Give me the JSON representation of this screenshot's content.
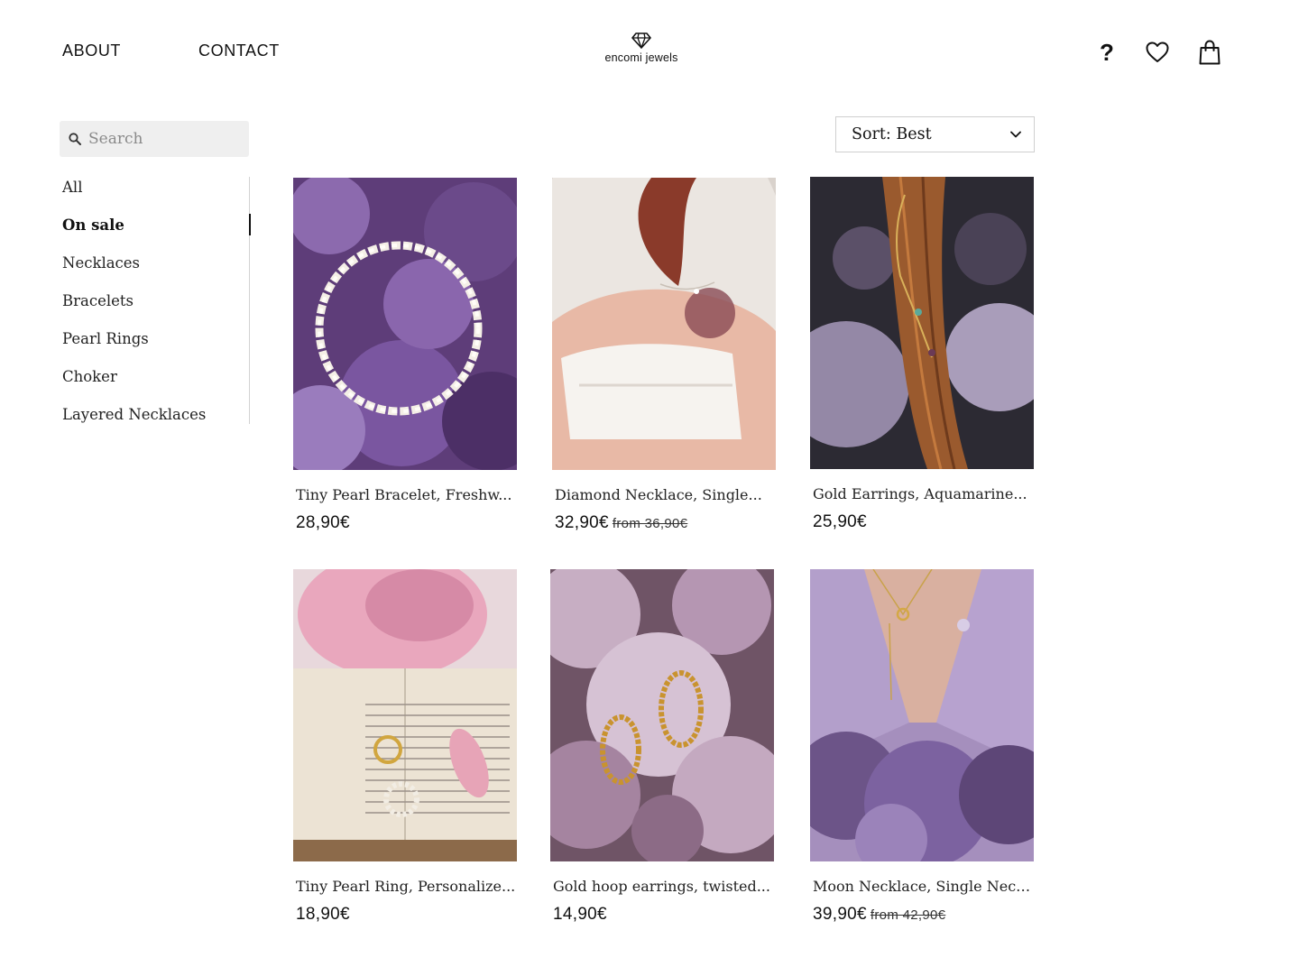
{
  "header": {
    "nav": [
      {
        "label": "ABOUT"
      },
      {
        "label": "CONTACT"
      }
    ],
    "brand": "encomi jewels",
    "icons": [
      "question-mark-icon",
      "heart-icon",
      "shopping-bag-icon"
    ],
    "help_glyph": "?"
  },
  "sidebar": {
    "search_placeholder": "Search",
    "categories": [
      {
        "label": "All",
        "active": false
      },
      {
        "label": "On sale",
        "active": true
      },
      {
        "label": "Necklaces",
        "active": false
      },
      {
        "label": "Bracelets",
        "active": false
      },
      {
        "label": "Pearl Rings",
        "active": false
      },
      {
        "label": "Choker",
        "active": false
      },
      {
        "label": "Layered Necklaces",
        "active": false
      }
    ]
  },
  "sort": {
    "label": "Sort: Best",
    "icon": "chevron-down-icon"
  },
  "products": [
    {
      "title": "Tiny Pearl Bracelet, Freshw...",
      "price": "28,90€",
      "old_price": ""
    },
    {
      "title": "Diamond Necklace,  Single...",
      "price": "32,90€",
      "old_price": "from 36,90€"
    },
    {
      "title": "Gold Earrings,  Aquamarine...",
      "price": "25,90€",
      "old_price": ""
    },
    {
      "title": "Tiny Pearl Ring, Personalize...",
      "price": "18,90€",
      "old_price": ""
    },
    {
      "title": "Gold hoop earrings, twisted...",
      "price": "14,90€",
      "old_price": ""
    },
    {
      "title": "Moon Necklace, Single Neckl...",
      "price": "39,90€",
      "old_price": "from 42,90€"
    }
  ],
  "colors": {
    "text": "#111111",
    "search_bg": "#efefef",
    "lilac": "#7a4f9a",
    "divider": "#d2d2d2"
  }
}
